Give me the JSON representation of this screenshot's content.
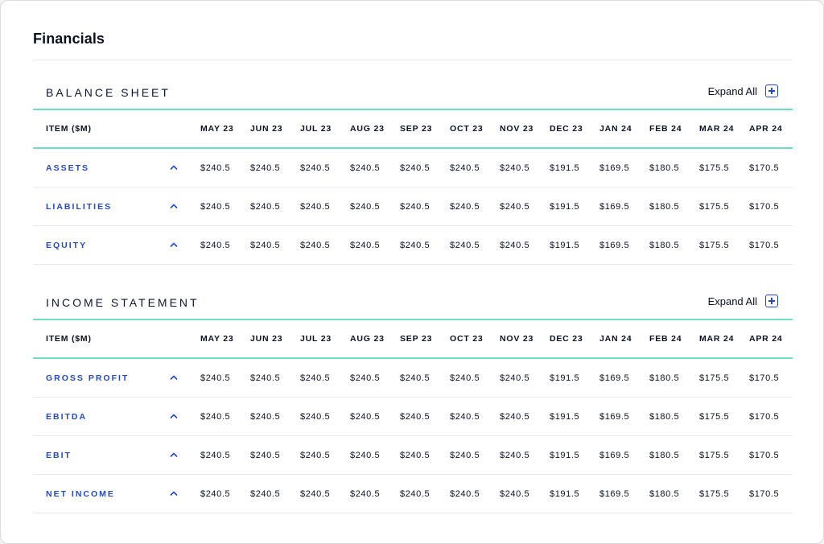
{
  "page": {
    "title": "Financials"
  },
  "expand_all_label": "Expand All",
  "item_header": "ITEM ($M)",
  "months": [
    "MAY 23",
    "JUN 23",
    "JUL 23",
    "AUG 23",
    "SEP 23",
    "OCT 23",
    "NOV 23",
    "DEC 23",
    "JAN 24",
    "FEB 24",
    "MAR 24",
    "APR 24"
  ],
  "values": [
    "$240.5",
    "$240.5",
    "$240.5",
    "$240.5",
    "$240.5",
    "$240.5",
    "$240.5",
    "$191.5",
    "$169.5",
    "$180.5",
    "$175.5",
    "$170.5"
  ],
  "sections": [
    {
      "title": "BALANCE SHEET",
      "rows": [
        {
          "label": "ASSETS"
        },
        {
          "label": "LIABILITIES"
        },
        {
          "label": "EQUITY"
        }
      ]
    },
    {
      "title": "INCOME STATEMENT",
      "rows": [
        {
          "label": "GROSS PROFIT"
        },
        {
          "label": "EBITDA"
        },
        {
          "label": "EBIT"
        },
        {
          "label": "NET INCOME"
        }
      ]
    }
  ],
  "colors": {
    "accent": "#2349c8",
    "rule_teal": "#6fdcc8",
    "text": "#0b1020"
  }
}
